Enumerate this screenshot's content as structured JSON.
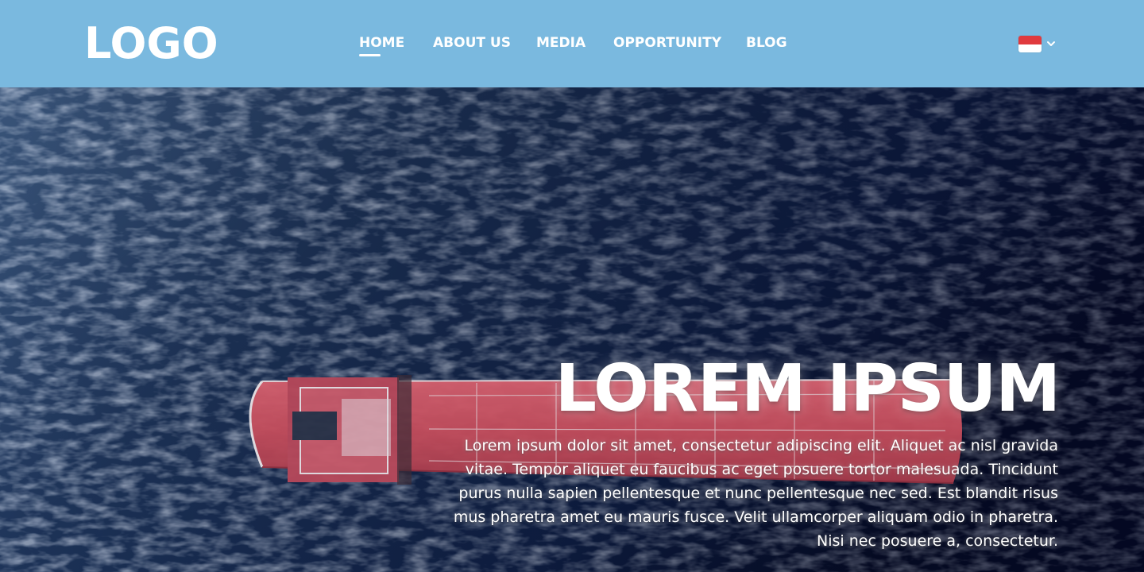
{
  "colors": {
    "header_bg": "#7ab9df",
    "sea_dark": "#0b1a38",
    "sea_mid": "#1f3a66",
    "ship_hull": "#c8505e",
    "flag_red": "#e03a3e",
    "flag_white": "#ffffff",
    "text": "#ffffff"
  },
  "header": {
    "logo": "LOGO",
    "nav": [
      {
        "label": "HOME",
        "active": true
      },
      {
        "label": "ABOUT US",
        "active": false
      },
      {
        "label": "MEDIA",
        "active": false
      },
      {
        "label": "OPPORTUNITY",
        "active": false
      },
      {
        "label": "BLOG",
        "active": false
      }
    ],
    "language": {
      "flag": "indonesia-flag-icon",
      "dropdown_icon": "chevron-down-icon"
    }
  },
  "hero": {
    "background": "aerial-sea-cargo-ship-image",
    "title": "LOREM IPSUM",
    "text": "Lorem ipsum dolor sit amet, consectetur adipiscing elit. Aliquet ac nisl gravida vitae. Tempor aliquet eu faucibus ac eget posuere tortor malesuada. Tincidunt purus nulla sapien pellentesque et nunc pellentesque nec sed. Est blandit risus mus pharetra amet eu mauris fusce. Velit ullamcorper aliquam odio in pharetra. Nisi nec posuere a, consectetur."
  }
}
